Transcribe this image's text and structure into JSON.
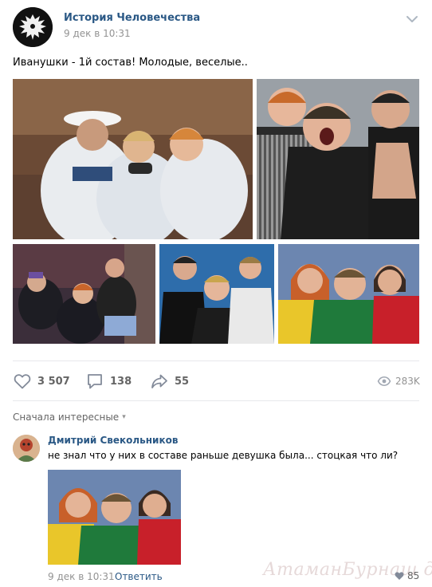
{
  "post": {
    "group_name": "История Человечества",
    "date": "9 дек в 10:31",
    "text": "Иванушки - 1й состав! Молодые, веселые..",
    "photos": [
      {
        "icon": "photo-sailors"
      },
      {
        "icon": "photo-leather-jackets"
      },
      {
        "icon": "photo-on-stairs"
      },
      {
        "icon": "photo-blue-background"
      },
      {
        "icon": "photo-colored-sweaters"
      }
    ]
  },
  "actions": {
    "likes": "3 507",
    "comments": "138",
    "shares": "55",
    "views": "283K"
  },
  "comments_sort": {
    "label": "Сначала интересные"
  },
  "comment": {
    "author": "Дмитрий Свекольников",
    "text": "не знал что у них в составе раньше девушка была... стоцкая что ли?",
    "date": "9 дек в 10:31",
    "reply_label": "Ответить",
    "likes": "85"
  },
  "watermark": "АтаманБурнаш для ЯП",
  "colors": {
    "link": "#2a5885",
    "muted": "#939393",
    "counter": "#656565",
    "divider": "#e7e8ec"
  }
}
